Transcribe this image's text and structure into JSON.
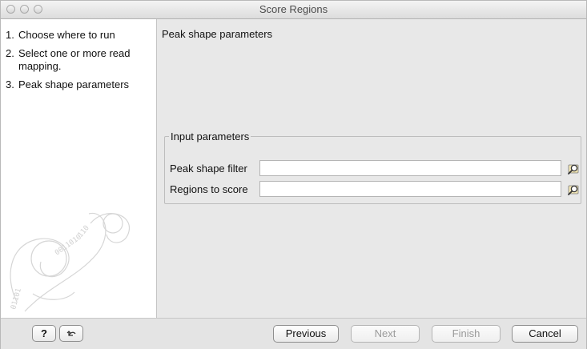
{
  "window": {
    "title": "Score Regions"
  },
  "sidebar": {
    "steps": [
      {
        "num": "1.",
        "label": "Choose where to run"
      },
      {
        "num": "2.",
        "label": "Select one or more read mapping."
      },
      {
        "num": "3.",
        "label": "Peak shape parameters"
      }
    ]
  },
  "main": {
    "panel_title": "Peak shape parameters",
    "group": {
      "legend": "Input parameters",
      "fields": [
        {
          "label": "Peak shape filter",
          "value": ""
        },
        {
          "label": "Regions to score",
          "value": ""
        }
      ]
    }
  },
  "footer": {
    "help_label": "?",
    "previous_label": "Previous",
    "next_label": "Next",
    "finish_label": "Finish",
    "cancel_label": "Cancel"
  },
  "icons": {
    "browse": "browse-icon",
    "reset": "reset-icon"
  }
}
